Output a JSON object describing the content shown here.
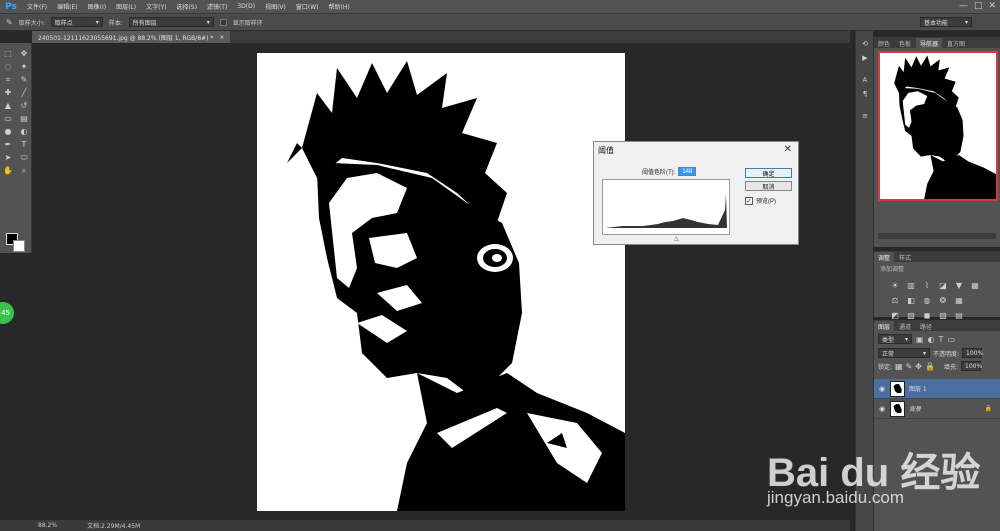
{
  "app": {
    "logo": "Ps",
    "colors": {
      "accent": "#31a8ff",
      "selection": "#4c6da0",
      "badge": "#3ac24c",
      "nav_border": "#d9363e"
    }
  },
  "menu": [
    "文件(F)",
    "编辑(E)",
    "图像(I)",
    "图层(L)",
    "文字(Y)",
    "选择(S)",
    "滤镜(T)",
    "3D(D)",
    "视图(V)",
    "窗口(W)",
    "帮助(H)"
  ],
  "window_controls": [
    "—",
    "□",
    "✕"
  ],
  "options": {
    "sample_size_label": "取样大小:",
    "sample_size_value": "取样点",
    "sample_label": "样本:",
    "sample_value": "所有图层",
    "ring_label": "显示取样环",
    "workspace": "基本功能"
  },
  "document": {
    "tab_title": "240501-121116230556​91.jpg @ 88.2% (图层 1, RGB/8#) *",
    "close": "×"
  },
  "status": {
    "zoom": "88.2%",
    "doc": "文档:2.29M/4.45M"
  },
  "badge_text": "45",
  "panels": {
    "top_tabs": [
      "颜色",
      "色板",
      "导航器",
      "直方图"
    ],
    "top_active": 2,
    "adjust_tabs": [
      "调整",
      "样式"
    ],
    "adjust_hint": "添加调整",
    "layer_tabs": [
      "图层",
      "通道",
      "路径"
    ],
    "layer_kind": "类型",
    "blend_mode": "正常",
    "opacity_label": "不透明度:",
    "opacity_value": "100%",
    "lock_label": "锁定:",
    "fill_label": "填充:",
    "fill_value": "100%",
    "layers": [
      {
        "name": "图层 1",
        "active": true
      },
      {
        "name": "背景",
        "active": false
      }
    ]
  },
  "dialog": {
    "title": "阈值",
    "level_label": "阈值色阶(T):",
    "level_value": "148",
    "ok": "确定",
    "cancel": "取消",
    "preview_label": "预览(P)",
    "preview_checked": "✓"
  },
  "watermark": {
    "brand": "Bai du 经验",
    "url": "jingyan.baidu.com"
  }
}
